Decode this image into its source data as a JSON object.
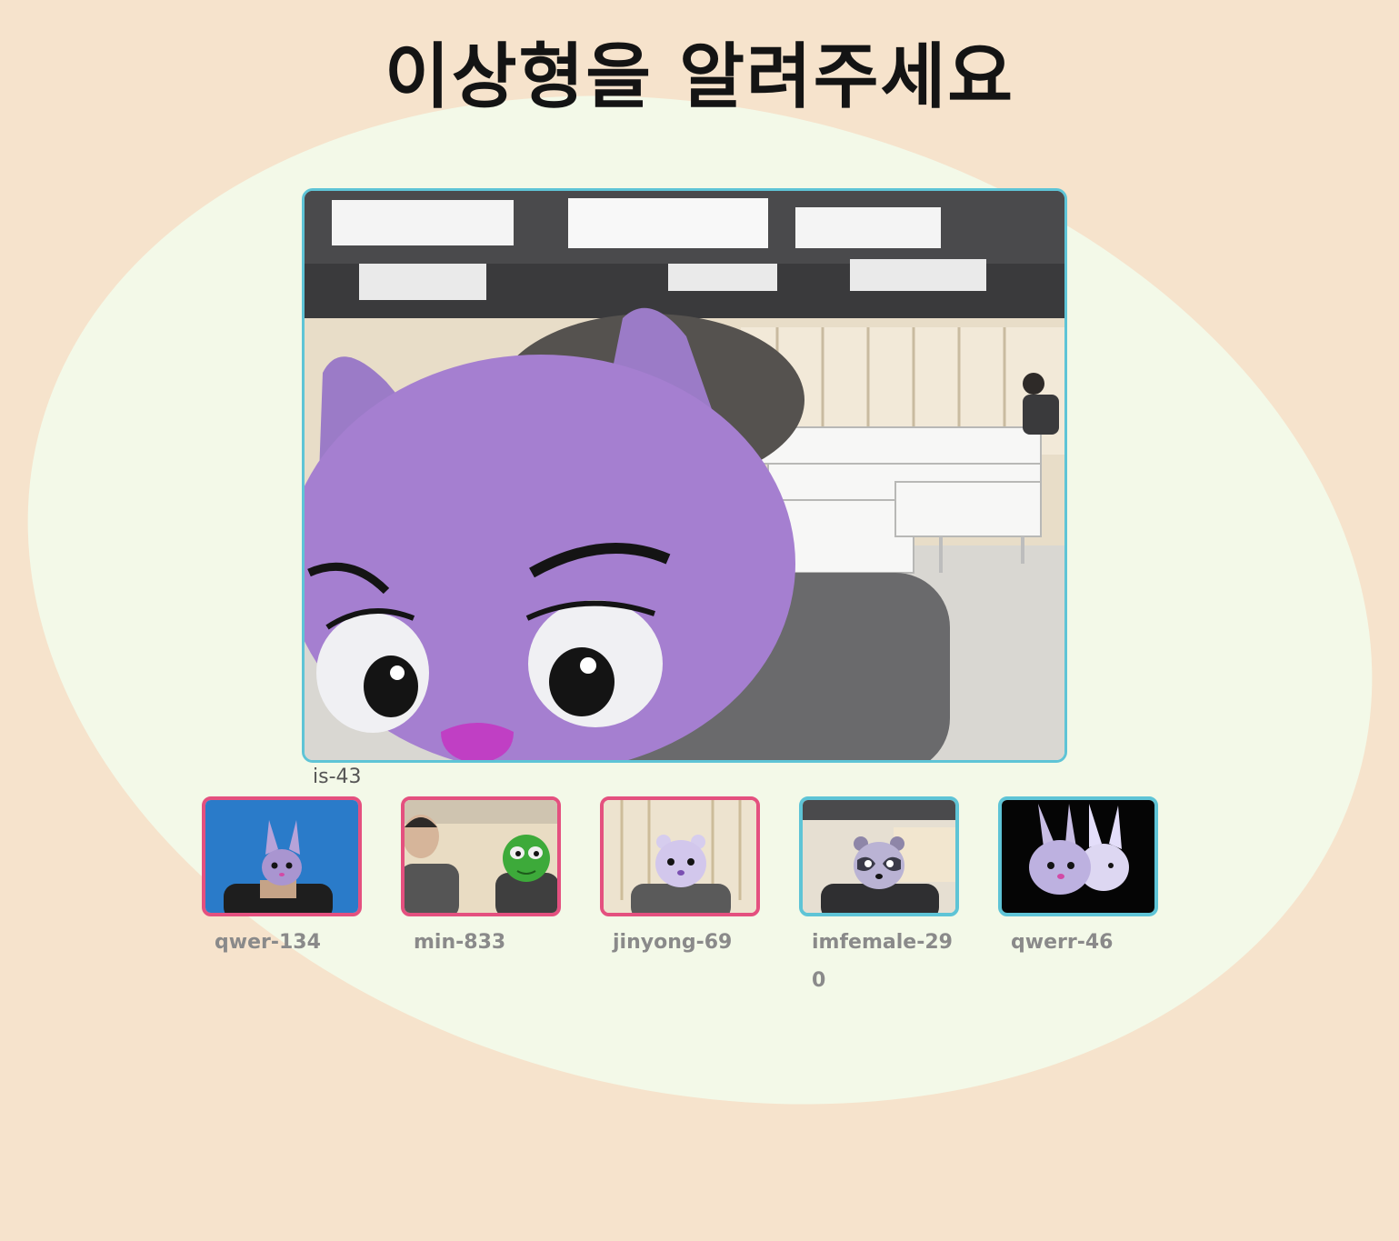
{
  "page": {
    "title": "이상형을 알려주세요"
  },
  "main_video": {
    "username": "is-43",
    "avatar": "purple-cat-mask"
  },
  "participants": [
    {
      "username": "qwer-134",
      "avatar": "purple-bunny-mask",
      "status": "highlighted"
    },
    {
      "username": "min-833",
      "avatar": "green-frog-mask",
      "status": "highlighted"
    },
    {
      "username": "jinyong-69",
      "avatar": "lavender-bear-mask",
      "status": "highlighted"
    },
    {
      "username": "imfemale-290",
      "avatar": "raccoon-mask",
      "status": "normal"
    },
    {
      "username": "qwerr-46",
      "avatar": "bunny-pair-mask",
      "status": "normal"
    }
  ],
  "colors": {
    "background": "#f6e3cc",
    "blob": "#f3f9e8",
    "highlight_border": "#e4507f",
    "normal_border": "#5ec4d6"
  }
}
